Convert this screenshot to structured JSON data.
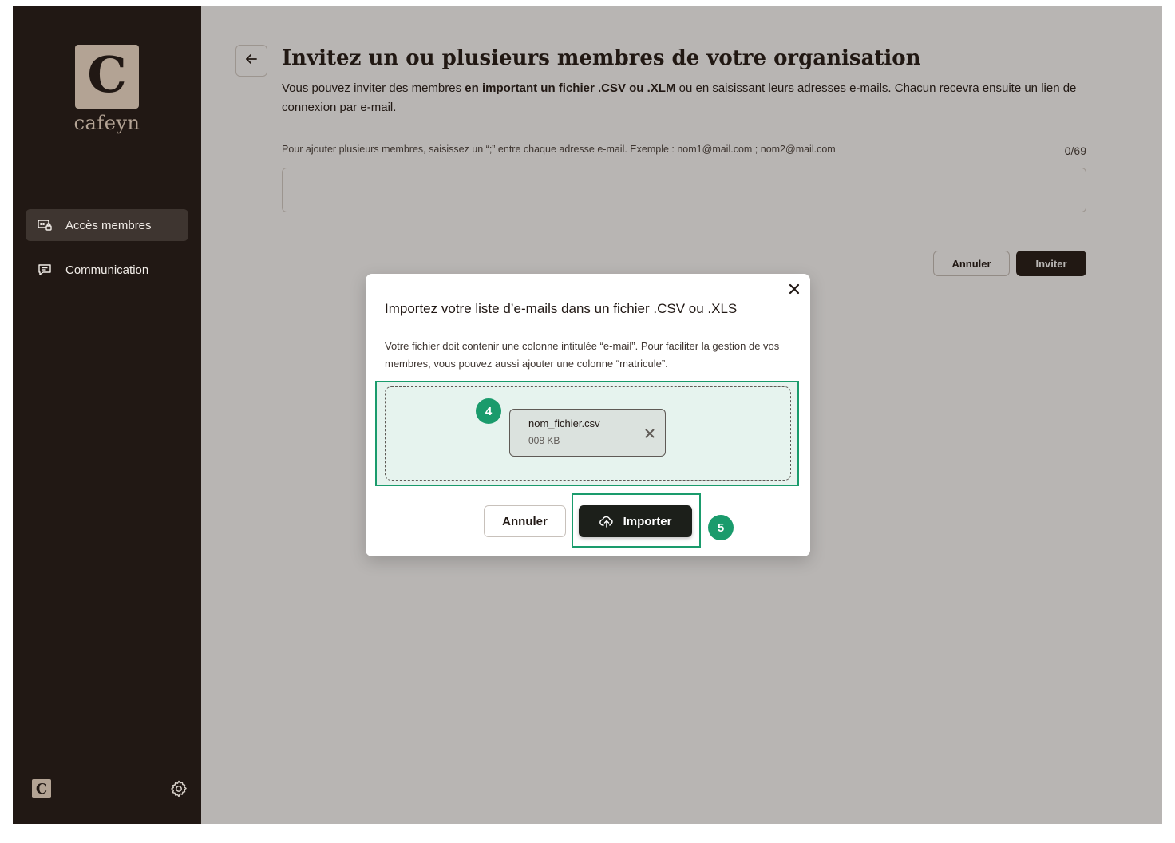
{
  "brand": {
    "logo_letter": "C",
    "logo_name": "cafeyn",
    "mini_letter": "C"
  },
  "sidebar": {
    "items": [
      {
        "label": "Accès membres",
        "icon": "members-access-icon",
        "active": true
      },
      {
        "label": "Communication",
        "icon": "chat-icon",
        "active": false
      }
    ],
    "settings_icon": "gear-icon"
  },
  "page": {
    "title": "Invitez un ou plusieurs membres de votre organisation",
    "desc_before": "Vous pouvez inviter des membres ",
    "desc_link": "en important un fichier .CSV ou .XLM",
    "desc_after": " ou en saisissant leurs adresses e-mails. Chacun recevra ensuite un lien de connexion par e-mail.",
    "hint": "Pour ajouter plusieurs membres, saisissez un “;” entre chaque adresse e-mail. Exemple : nom1@mail.com ; nom2@mail.com",
    "counter_current": "0",
    "counter_max": "/69",
    "email_value": "",
    "cancel_label": "Annuler",
    "invite_label": "Inviter"
  },
  "modal": {
    "title": "Importez votre liste d’e-mails dans un fichier .CSV ou .XLS",
    "description": "Votre fichier doit contenir une colonne intitulée “e-mail”. Pour faciliter la gestion de vos membres, vous pouvez aussi ajouter une colonne “matricule”.",
    "file": {
      "name": "nom_fichier.csv",
      "size": "008 KB"
    },
    "cancel_label": "Annuler",
    "import_label": "Importer"
  },
  "annotations": {
    "step_4": "4",
    "step_5": "5"
  },
  "colors": {
    "sidebar_bg": "#211814",
    "brand_tan": "#b3a394",
    "highlight_green": "#1a9b6c",
    "button_dark": "#1c1f1a"
  }
}
